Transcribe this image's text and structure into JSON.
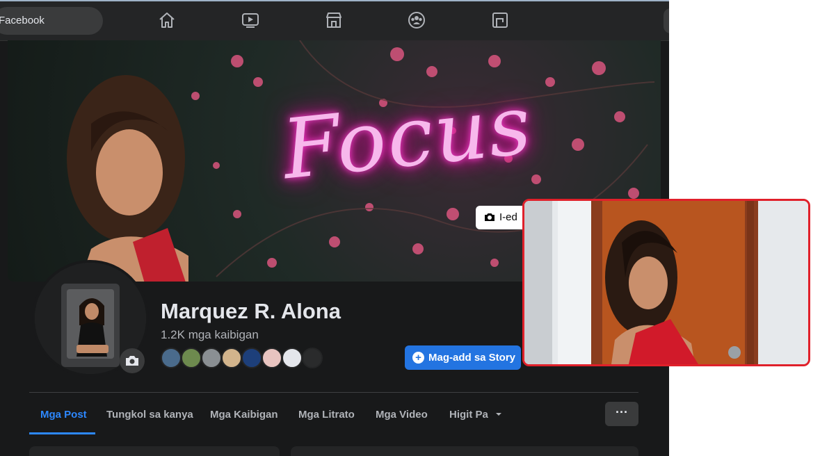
{
  "topbar": {
    "search_text": "Facebook",
    "nav_icons": [
      "home-icon",
      "video-icon",
      "marketplace-icon",
      "groups-icon",
      "gaming-icon"
    ]
  },
  "cover": {
    "neon_text": "Focus",
    "edit_button_label": "I-ed"
  },
  "profile": {
    "name": "Marquez R. Alona",
    "friends_count": "1.2K mga kaibigan",
    "story_button_label": "Mag-add sa Story"
  },
  "tabs": [
    {
      "label": "Mga Post",
      "active": true
    },
    {
      "label": "Tungkol sa kanya",
      "active": false
    },
    {
      "label": "Mga Kaibigan",
      "active": false
    },
    {
      "label": "Mga Litrato",
      "active": false
    },
    {
      "label": "Mga Video",
      "active": false
    },
    {
      "label": "Higit Pa",
      "active": false
    }
  ],
  "more_button_label": "···",
  "colors": {
    "accent": "#2d88ff",
    "button_blue": "#2374e1",
    "background": "#18191a",
    "surface": "#242526",
    "highlight_border": "#e0202a"
  }
}
